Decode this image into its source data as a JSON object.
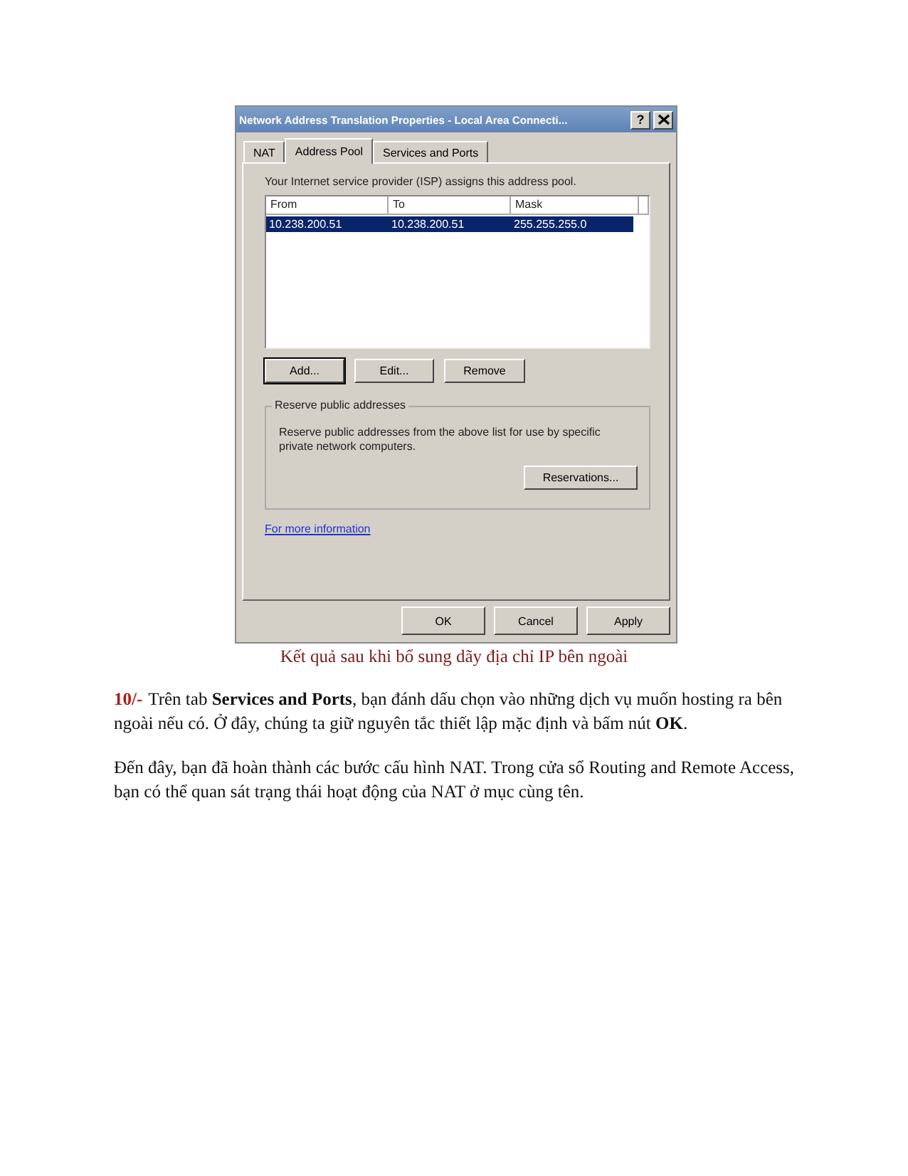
{
  "dialog": {
    "title": "Network Address Translation Properties - Local Area Connecti...",
    "help_button": "?",
    "tabs": [
      {
        "label": "NAT",
        "selected": false
      },
      {
        "label": "Address Pool",
        "selected": true
      },
      {
        "label": "Services and Ports",
        "selected": false
      }
    ],
    "description": "Your Internet service provider (ISP) assigns this address pool.",
    "table": {
      "columns": [
        "From",
        "To",
        "Mask"
      ],
      "rows": [
        {
          "cells": [
            "10.238.200.51",
            "10.238.200.51",
            "255.255.255.0"
          ],
          "selected": true
        }
      ]
    },
    "list_buttons": [
      "Add...",
      "Edit...",
      "Remove"
    ],
    "group": {
      "title": "Reserve public addresses",
      "text": "Reserve public addresses from the above list for use by specific private network computers.",
      "button": "Reservations..."
    },
    "link": "For more information",
    "footer_buttons": [
      "OK",
      "Cancel",
      "Apply"
    ]
  },
  "caption": "Kết quả sau khi bổ sung dãy địa chỉ IP bên ngoài",
  "paragraphs": [
    {
      "lead": "10/-",
      "text": "Trên tab **Services and Ports**, bạn đánh dấu chọn vào những dịch vụ muốn hosting ra bên ngoài nếu có. Ở đây, chúng ta giữ nguyên tắc thiết lập mặc định và bấm nút **OK**."
    },
    {
      "text": "Đến đây, bạn đã hoàn thành các bước cấu hình NAT. Trong cửa sổ Routing and Remote Access, bạn có thể quan sát trạng thái hoạt động của NAT ở mục cùng tên."
    }
  ]
}
